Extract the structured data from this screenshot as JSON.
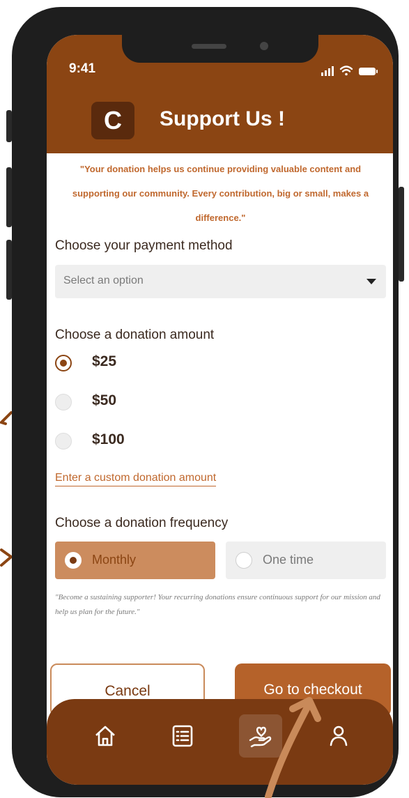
{
  "status_bar": {
    "time": "9:41"
  },
  "header": {
    "logo_letter": "C",
    "title": "Support  Us !"
  },
  "intro_text": "\"Your donation helps us continue providing valuable content and supporting our community. Every contribution, big or small, makes a difference.\"",
  "payment": {
    "label": "Choose your payment method",
    "placeholder": "Select an option"
  },
  "amount": {
    "label": "Choose a donation amount",
    "options": [
      {
        "label": "$25",
        "selected": true
      },
      {
        "label": "$50",
        "selected": false
      },
      {
        "label": "$100",
        "selected": false
      }
    ],
    "custom_link": "Enter a custom donation amount"
  },
  "frequency": {
    "label": "Choose a donation frequency",
    "options": [
      {
        "label": "Monthly",
        "selected": true
      },
      {
        "label": "One time",
        "selected": false
      }
    ],
    "note": "\"Become a sustaining supporter! Your recurring donations ensure continuous support for our mission and help us plan for the future.\""
  },
  "actions": {
    "cancel": "Cancel",
    "checkout": "Go to checkout"
  },
  "tabbar": {
    "icons": [
      "home-icon",
      "list-icon",
      "donate-hand-heart-icon",
      "user-icon"
    ],
    "active_index": 2
  },
  "colors": {
    "brand": "#8b4513",
    "accent": "#c0682e",
    "checkout": "#b5622a",
    "tabbar": "#7a3a12"
  }
}
